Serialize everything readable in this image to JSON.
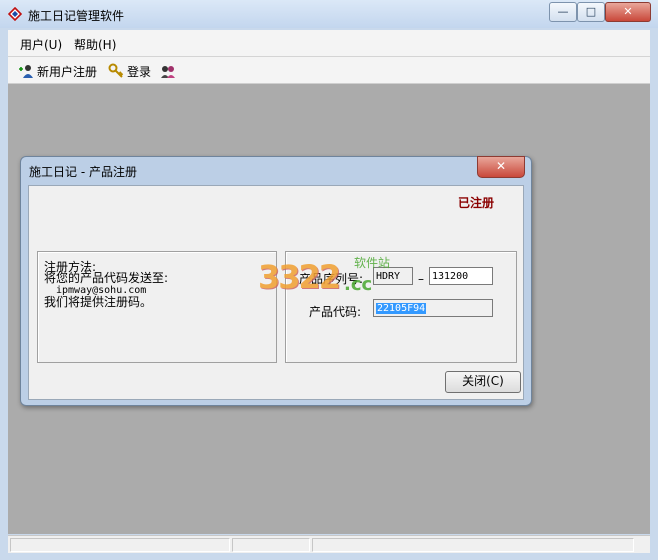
{
  "window": {
    "title": "施工日记管理软件",
    "controls": {
      "minimize": "—",
      "maximize": "□",
      "close": "✕"
    }
  },
  "menubar": {
    "items": [
      "用户(U)",
      "帮助(H)"
    ]
  },
  "toolbar": {
    "new_user": "新用户注册",
    "login": "登录"
  },
  "dialog": {
    "title": "施工日记 - 产品注册",
    "close": "✕",
    "status": "已注册",
    "instructions": {
      "heading": "注册方法:",
      "line1": "将您的产品代码发送至:",
      "email": "ipmway@sohu.com",
      "line3": "我们将提供注册码。"
    },
    "serial_label": "产品序列号:",
    "serial_part1": "HDRY",
    "serial_separator": "–",
    "serial_part2": "131200",
    "code_label": "产品代码:",
    "code_value": "22105F94",
    "close_button": "关闭(C)"
  },
  "watermark": {
    "number": "3322",
    "domain": ".cc",
    "text": "软件站"
  },
  "colors": {
    "status_red": "#8b0000",
    "selection_blue": "#3399ff",
    "close_red": "#c9483a"
  }
}
